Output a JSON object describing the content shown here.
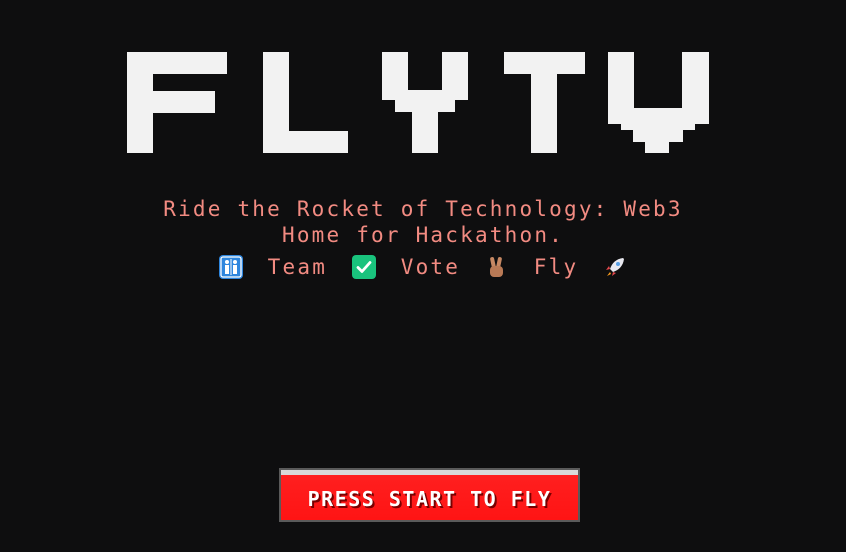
{
  "logo": {
    "text": "FLYTV",
    "color": "#f2f2f2"
  },
  "tagline": {
    "line1": "Ride the Rocket of Technology: Web3",
    "line2": "Home for Hackathon.",
    "color": "#f28b82"
  },
  "features": [
    {
      "icon": "people-icon",
      "label": "Team"
    },
    {
      "icon": "check-box-icon",
      "label": "Vote"
    },
    {
      "icon": "victory-hand-icon",
      "label": "Fly"
    },
    {
      "icon": "rocket-icon",
      "label": ""
    }
  ],
  "cta": {
    "label": "PRESS START TO FLY",
    "color": "#ff1414"
  }
}
